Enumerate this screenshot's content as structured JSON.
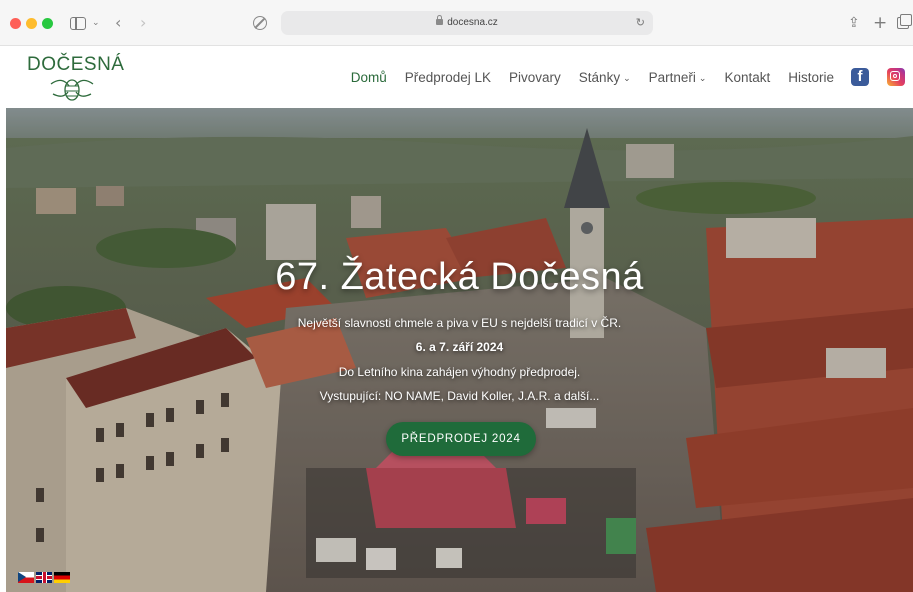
{
  "browser": {
    "url": "docesna.cz"
  },
  "site": {
    "logo_text": "DOČESNÁ"
  },
  "nav": {
    "items": [
      {
        "label": "Domů",
        "active": true,
        "dropdown": false
      },
      {
        "label": "Předprodej LK",
        "active": false,
        "dropdown": false
      },
      {
        "label": "Pivovary",
        "active": false,
        "dropdown": false
      },
      {
        "label": "Stánky",
        "active": false,
        "dropdown": true
      },
      {
        "label": "Partneři",
        "active": false,
        "dropdown": true
      },
      {
        "label": "Kontakt",
        "active": false,
        "dropdown": false
      },
      {
        "label": "Historie",
        "active": false,
        "dropdown": false
      }
    ],
    "social": [
      "facebook-icon",
      "instagram-icon"
    ]
  },
  "hero": {
    "title": "67. Žatecká Dočesná",
    "line1": "Největší slavnosti chmele a piva v EU s nejdelší tradicí v ČR.",
    "line2": "6. a 7. září 2024",
    "line3": "Do Letního kina zahájen výhodný předprodej.",
    "line4": "Vystupující: NO NAME, David Koller, J.A.R. a další...",
    "cta_label": "PŘEDPRODEJ 2024"
  },
  "languages": [
    "cs",
    "en",
    "de"
  ],
  "colors": {
    "brand_green": "#1f6b3a",
    "nav_active": "#2a6a3a",
    "nav_text": "#555555"
  }
}
